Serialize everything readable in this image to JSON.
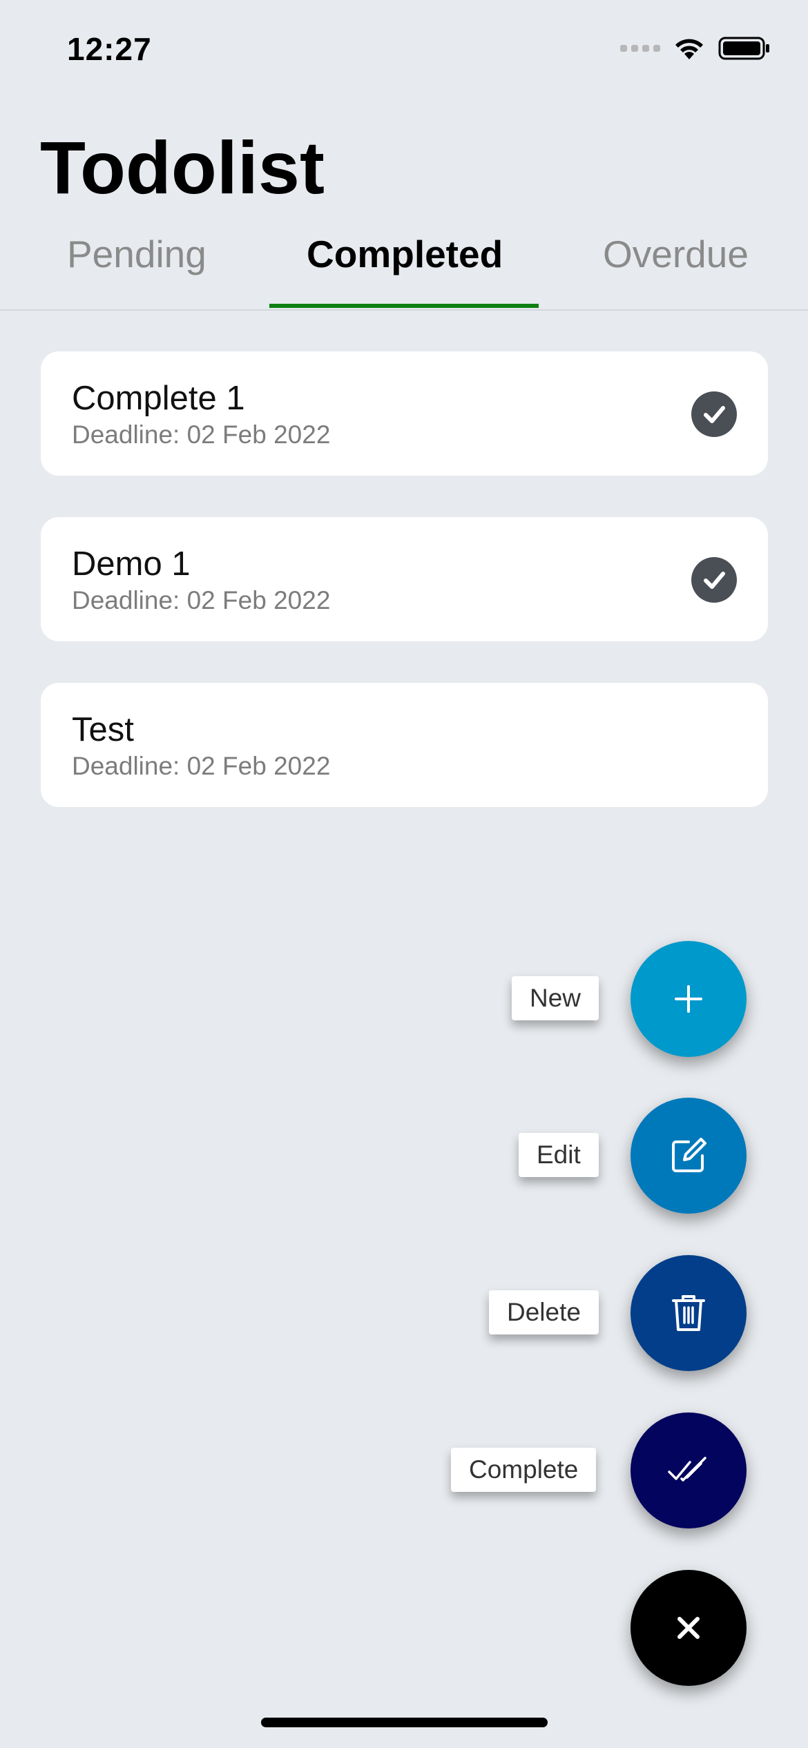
{
  "status_bar": {
    "time": "12:27"
  },
  "header": {
    "title": "Todolist"
  },
  "tabs": [
    {
      "label": "Pending"
    },
    {
      "label": "Completed"
    },
    {
      "label": "Overdue"
    }
  ],
  "tasks": [
    {
      "title": "Complete 1",
      "deadline": "Deadline: 02 Feb 2022",
      "completed": true
    },
    {
      "title": "Demo 1",
      "deadline": "Deadline: 02 Feb 2022",
      "completed": true
    },
    {
      "title": "Test",
      "deadline": "Deadline: 02 Feb 2022",
      "completed": false
    }
  ],
  "fab_menu": {
    "new_label": "New",
    "edit_label": "Edit",
    "delete_label": "Delete",
    "complete_label": "Complete"
  },
  "colors": {
    "background": "#e7eaee",
    "tab_indicator": "#0e8012",
    "fab_new": "#0099cc",
    "fab_edit": "#0079bb",
    "fab_delete": "#023e8a",
    "fab_complete": "#03045e",
    "fab_close": "#000000"
  },
  "icons": {
    "new": "plus-icon",
    "edit": "edit-icon",
    "delete": "trash-icon",
    "complete": "double-check-icon",
    "close": "close-icon"
  }
}
